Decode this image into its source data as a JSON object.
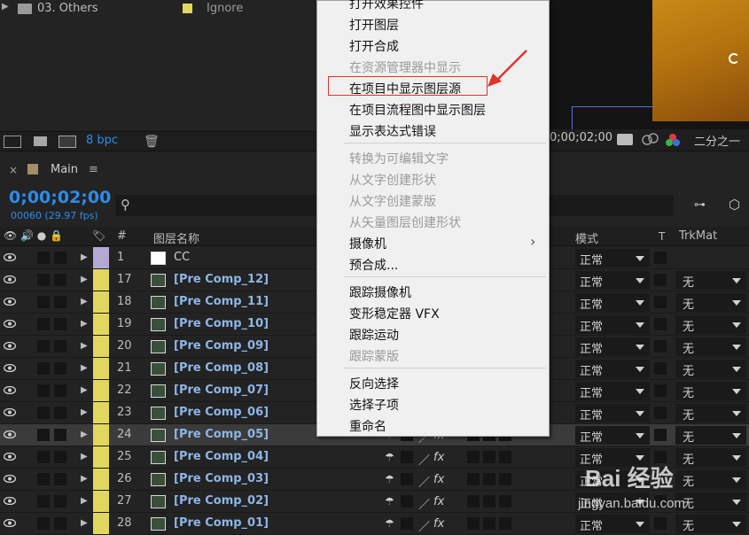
{
  "project": {
    "folder_name": "03. Others",
    "folder_label": "Ignore",
    "bpc": "8 bpc"
  },
  "viewer": {
    "timecode": "0;00;02;00",
    "resolution": "二分之一"
  },
  "timeline": {
    "comp_tab": "Main",
    "current_time": "0;00;02;00",
    "frame_info": "00060 (29.97 fps)",
    "search_placeholder": "",
    "col_hash": "#",
    "col_layer_name": "图层名称",
    "col_mode": "模式",
    "col_t": "T",
    "col_trkmat": "TrkMat",
    "rows": [
      {
        "num": "1",
        "name": "CC",
        "mode": "正常",
        "trk": "",
        "label_color": "#b3aad4",
        "solid": true
      },
      {
        "num": "17",
        "name": "[Pre Comp_12]",
        "mode": "正常",
        "trk": "无",
        "label_color": "#e2d75e"
      },
      {
        "num": "18",
        "name": "[Pre Comp_11]",
        "mode": "正常",
        "trk": "无",
        "label_color": "#e2d75e"
      },
      {
        "num": "19",
        "name": "[Pre Comp_10]",
        "mode": "正常",
        "trk": "无",
        "label_color": "#e2d75e"
      },
      {
        "num": "20",
        "name": "[Pre Comp_09]",
        "mode": "正常",
        "trk": "无",
        "label_color": "#e2d75e"
      },
      {
        "num": "21",
        "name": "[Pre Comp_08]",
        "mode": "正常",
        "trk": "无",
        "label_color": "#e2d75e"
      },
      {
        "num": "22",
        "name": "[Pre Comp_07]",
        "mode": "正常",
        "trk": "无",
        "label_color": "#e2d75e"
      },
      {
        "num": "23",
        "name": "[Pre Comp_06]",
        "mode": "正常",
        "trk": "无",
        "label_color": "#e2d75e"
      },
      {
        "num": "24",
        "name": "[Pre Comp_05]",
        "mode": "正常",
        "trk": "无",
        "label_color": "#e2d75e",
        "selected": true
      },
      {
        "num": "25",
        "name": "[Pre Comp_04]",
        "mode": "正常",
        "trk": "无",
        "label_color": "#e2d75e"
      },
      {
        "num": "26",
        "name": "[Pre Comp_03]",
        "mode": "正常",
        "trk": "无",
        "label_color": "#e2d75e"
      },
      {
        "num": "27",
        "name": "[Pre Comp_02]",
        "mode": "正常",
        "trk": "无",
        "label_color": "#e2d75e"
      },
      {
        "num": "28",
        "name": "[Pre Comp_01]",
        "mode": "正常",
        "trk": "无",
        "label_color": "#e2d75e"
      }
    ]
  },
  "context_menu": {
    "items": [
      {
        "label": "打开效果控件",
        "disabled": false
      },
      {
        "label": "打开图层",
        "disabled": false
      },
      {
        "label": "打开合成",
        "disabled": false
      },
      {
        "label": "在资源管理器中显示",
        "disabled": true
      },
      {
        "label": "在项目中显示图层源",
        "disabled": false,
        "highlighted": true
      },
      {
        "label": "在项目流程图中显示图层",
        "disabled": false
      },
      {
        "label": "显示表达式错误",
        "disabled": false
      },
      {
        "label": "转换为可编辑文字",
        "disabled": true
      },
      {
        "label": "从文字创建形状",
        "disabled": true
      },
      {
        "label": "从文字创建蒙版",
        "disabled": true
      },
      {
        "label": "从矢量图层创建形状",
        "disabled": true
      },
      {
        "label": "摄像机",
        "disabled": false,
        "submenu": true
      },
      {
        "label": "预合成...",
        "disabled": false
      },
      {
        "label": "跟踪摄像机",
        "disabled": false
      },
      {
        "label": "变形稳定器 VFX",
        "disabled": false
      },
      {
        "label": "跟踪运动",
        "disabled": false
      },
      {
        "label": "跟踪蒙版",
        "disabled": true
      },
      {
        "label": "反向选择",
        "disabled": false
      },
      {
        "label": "选择子项",
        "disabled": false
      },
      {
        "label": "重命名",
        "disabled": false
      }
    ],
    "submenu_arrow": "›"
  },
  "watermark": {
    "brand": "Bai 经验",
    "url": "jingyan.baidu.com"
  },
  "colors": {
    "accent_blue": "#2d8ceb",
    "highlight_red": "#e0332a",
    "layer_name_blue": "#8fb5e6"
  }
}
